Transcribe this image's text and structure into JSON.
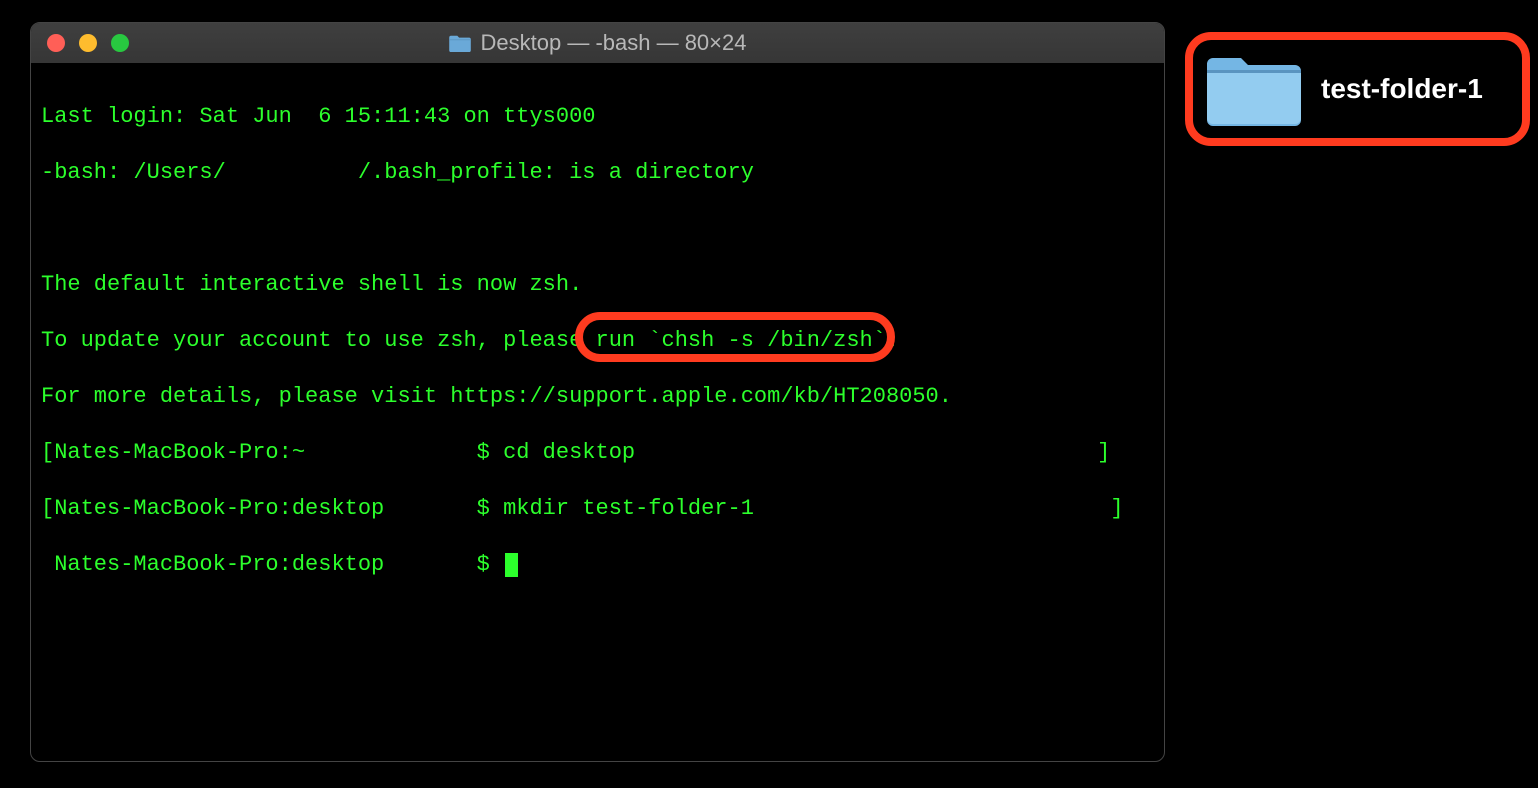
{
  "window": {
    "title": "Desktop — -bash — 80×24"
  },
  "terminal": {
    "l1": "Last login: Sat Jun  6 15:11:43 on ttys000",
    "l2": "-bash: /Users/          /.bash_profile: is a directory",
    "l3": "",
    "l4": "The default interactive shell is now zsh.",
    "l5": "To update your account to use zsh, please run `chsh -s /bin/zsh`.",
    "l6": "For more details, please visit https://support.apple.com/kb/HT208050.",
    "l7": "[Nates-MacBook-Pro:~             $ cd desktop                                   ]",
    "l8": "[Nates-MacBook-Pro:desktop       $ mkdir test-folder-1                           ]",
    "l9_prefix": " Nates-MacBook-Pro:desktop       $ "
  },
  "desktop": {
    "folder_name": "test-folder-1"
  }
}
